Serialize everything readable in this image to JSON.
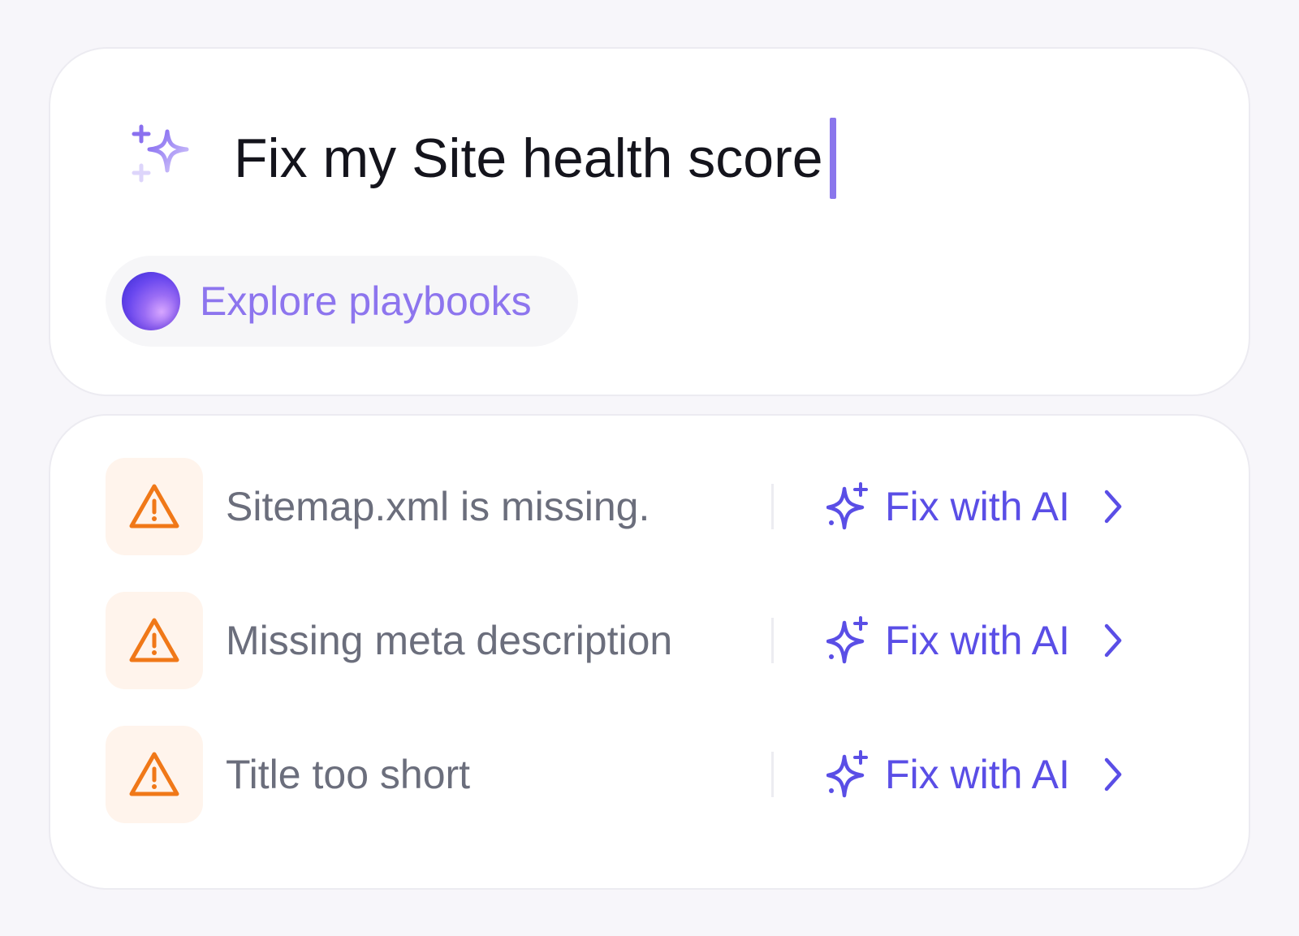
{
  "prompt": {
    "text": "Fix my Site health score",
    "icon": "sparkles-icon"
  },
  "playbooks": {
    "label": "Explore playbooks",
    "icon": "gradient-orb-icon"
  },
  "issues": [
    {
      "text": "Sitemap.xml is missing.",
      "icon": "warning-triangle-icon",
      "action": "Fix with AI"
    },
    {
      "text": "Missing meta description",
      "icon": "warning-triangle-icon",
      "action": "Fix with AI"
    },
    {
      "text": "Title too short",
      "icon": "warning-triangle-icon",
      "action": "Fix with AI"
    }
  ],
  "colors": {
    "accent": "#5a4ee6",
    "accent_light": "#8d75ee",
    "warning": "#f07818",
    "warning_bg": "#fff4ec",
    "background": "#f7f6fa"
  }
}
